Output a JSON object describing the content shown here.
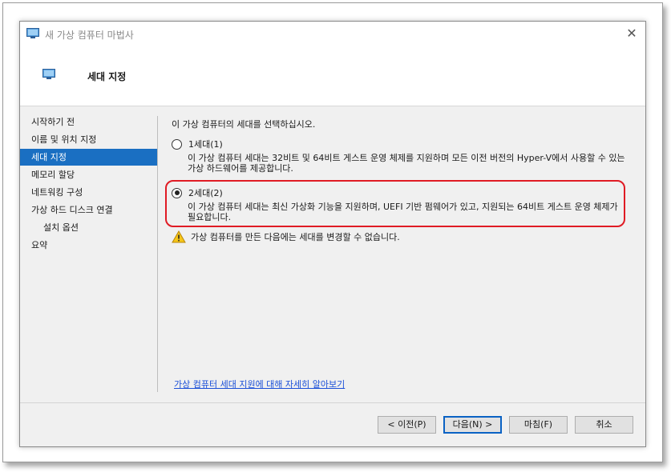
{
  "window": {
    "title": "새 가상 컴퓨터 마법사",
    "close": "✕"
  },
  "header": {
    "title": "세대 지정"
  },
  "nav": {
    "items": [
      {
        "label": "시작하기 전"
      },
      {
        "label": "이름 및 위치 지정"
      },
      {
        "label": "세대 지정"
      },
      {
        "label": "메모리 할당"
      },
      {
        "label": "네트워킹 구성"
      },
      {
        "label": "가상 하드 디스크 연결"
      },
      {
        "label": "설치 옵션"
      },
      {
        "label": "요약"
      }
    ]
  },
  "content": {
    "prompt": "이 가상 컴퓨터의 세대를 선택하십시오.",
    "options": [
      {
        "label": "1세대(1)",
        "description": "이 가상 컴퓨터 세대는 32비트 및 64비트 게스트 운영 체제를 지원하며 모든 이전 버전의 Hyper-V에서 사용할 수 있는 가상 하드웨어를 제공합니다."
      },
      {
        "label": "2세대(2)",
        "description": "이 가상 컴퓨터 세대는 최신 가상화 기능을 지원하며, UEFI 기반 펌웨어가 있고, 지원되는 64비트 게스트 운영 체제가 필요합니다."
      }
    ],
    "warning": "가상 컴퓨터를 만든 다음에는 세대를 변경할 수 없습니다.",
    "learn_more": "가상 컴퓨터 세대 지원에 대해 자세히 알아보기"
  },
  "buttons": {
    "previous": "< 이전(P)",
    "next": "다음(N) >",
    "finish": "마침(F)",
    "cancel": "취소"
  },
  "colors": {
    "nav_active": "#1a6fc2",
    "highlight_border": "#e01b24",
    "link": "#1a4fd8"
  }
}
